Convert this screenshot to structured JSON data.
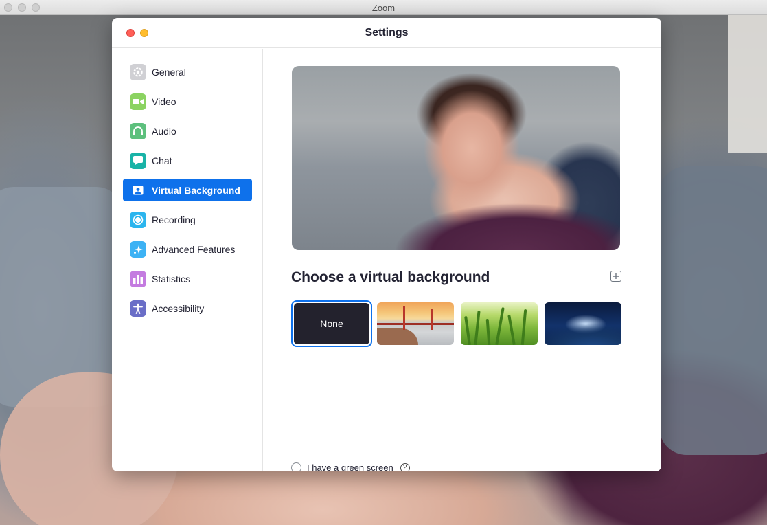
{
  "window": {
    "title": "Zoom"
  },
  "dialog": {
    "title": "Settings"
  },
  "sidebar": {
    "items": [
      {
        "label": "General",
        "icon": "gear-icon",
        "color": "#d0d0d4"
      },
      {
        "label": "Video",
        "icon": "video-camera-icon",
        "color": "#8bd361"
      },
      {
        "label": "Audio",
        "icon": "headphones-icon",
        "color": "#5dc07d"
      },
      {
        "label": "Chat",
        "icon": "chat-bubble-icon",
        "color": "#19b3a7"
      },
      {
        "label": "Virtual Background",
        "icon": "virtual-background-icon",
        "color": "#0e71eb",
        "active": true
      },
      {
        "label": "Recording",
        "icon": "record-icon",
        "color": "#2bb5ee"
      },
      {
        "label": "Advanced Features",
        "icon": "sparkle-icon",
        "color": "#3db2f4"
      },
      {
        "label": "Statistics",
        "icon": "bar-chart-icon",
        "color": "#c47be0"
      },
      {
        "label": "Accessibility",
        "icon": "accessibility-icon",
        "color": "#6a6ec7"
      }
    ]
  },
  "main": {
    "heading": "Choose a virtual background",
    "add_icon": "plus-square-icon",
    "backgrounds": [
      {
        "label": "None",
        "selected": true
      },
      {
        "label": "",
        "image": "golden-gate-bridge"
      },
      {
        "label": "",
        "image": "grass"
      },
      {
        "label": "",
        "image": "earth-from-space"
      }
    ],
    "green_screen_label": "I have a green screen",
    "green_screen_checked": false,
    "help_glyph": "?"
  },
  "colors": {
    "accent": "#0e71eb",
    "close": "#ff5f57",
    "minimize": "#ffbd2e"
  }
}
